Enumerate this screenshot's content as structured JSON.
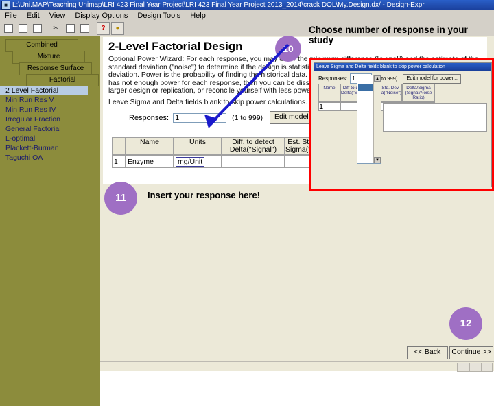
{
  "window": {
    "icon": "app-icon",
    "title": "L:\\Uni.MAP\\Teaching Unimap\\LRI 423 Final Year Project\\LRI 423 Final Year Project 2013_2014\\crack DOL\\My.Design.dx/ - Design-Expr"
  },
  "menu": {
    "items": [
      "File",
      "Edit",
      "View",
      "Display Options",
      "Design Tools",
      "Help"
    ]
  },
  "toolbar": {
    "buttons": [
      {
        "name": "new-icon",
        "glyph": "□"
      },
      {
        "name": "open-icon",
        "glyph": "□"
      },
      {
        "name": "save-icon",
        "glyph": "□"
      },
      {
        "name": "cut-icon",
        "glyph": "✂"
      },
      {
        "name": "copy-icon",
        "glyph": "□"
      },
      {
        "name": "paste-icon",
        "glyph": "□"
      },
      {
        "name": "help-icon",
        "glyph": "?"
      },
      {
        "name": "tip-icon",
        "glyph": "☀"
      }
    ]
  },
  "sidebar": {
    "tabs": [
      "Combined",
      "Mixture",
      "Response Surface",
      "Factorial"
    ],
    "items": [
      "2 Level Factorial",
      "Min Run Res V",
      "Min Run Res IV",
      "Irregular Fraction",
      "General Factorial",
      "L-optimal",
      "Plackett-Burman",
      "Taguchi OA"
    ],
    "selected": "2 Level Factorial"
  },
  "main": {
    "title": "2-Level Factorial Design",
    "paragraph1": "Optional Power Wizard: For each response, you may enter the minimum difference (\"signal\") and the estimate of the standard deviation (\"noise\") to determine if the design is statistically significant and also the estimated standard deviation. Power is the probability of finding the historical data. A probability of 80% or higher is nice. If your design has not enough power for each response, then you can be dissatisfied in the likelihood of your results by choosing a larger design or replication, or reconcile yourself with less power.",
    "paragraph2": "Leave Sigma and Delta fields blank to skip power calculations.",
    "response_label": "Responses:",
    "response_value": "1",
    "response_range": "(1 to 999)",
    "edit_model_button": "Edit model...",
    "grid": {
      "headers": [
        "Name",
        "Units",
        "Diff. to detect Delta(\"Signal\")",
        "Est. Std. Dev. Sigma(\"Noise\")"
      ],
      "row_label": "1",
      "rows": [
        {
          "name": "Enzyme Activity",
          "units": "mg/Unit",
          "delta": "",
          "sigma": ""
        }
      ]
    },
    "nav": {
      "back": "<< Back",
      "continue": "Continue >>"
    }
  },
  "dialog": {
    "title": "Leave Sigma and Delta fields blank to skip power calculation",
    "responses_label": "Responses:",
    "responses_value": "1",
    "responses_range": "(1 to 999)",
    "calc_button": "Edit model for power...",
    "grid_headers": [
      "Name",
      "Diff to detect Delta(\"Signal\")",
      "Est. Std. Dev. Sigma(\"Noise\")",
      "Delta/Sigma (Signal/Noise Ratio)"
    ],
    "row_label": "1",
    "listbox_selected": "1"
  },
  "annotations": {
    "heading": "Choose number of response in your study",
    "badge_10": "10",
    "badge_11": "11",
    "badge_12": "12",
    "response_note": "Insert your response here!",
    "arrow_color": "#1a1acc",
    "badge_color": "#9f6fc4",
    "box_color": "#ff0000"
  },
  "statusbar": {
    "cells": [
      "",
      "",
      ""
    ]
  }
}
